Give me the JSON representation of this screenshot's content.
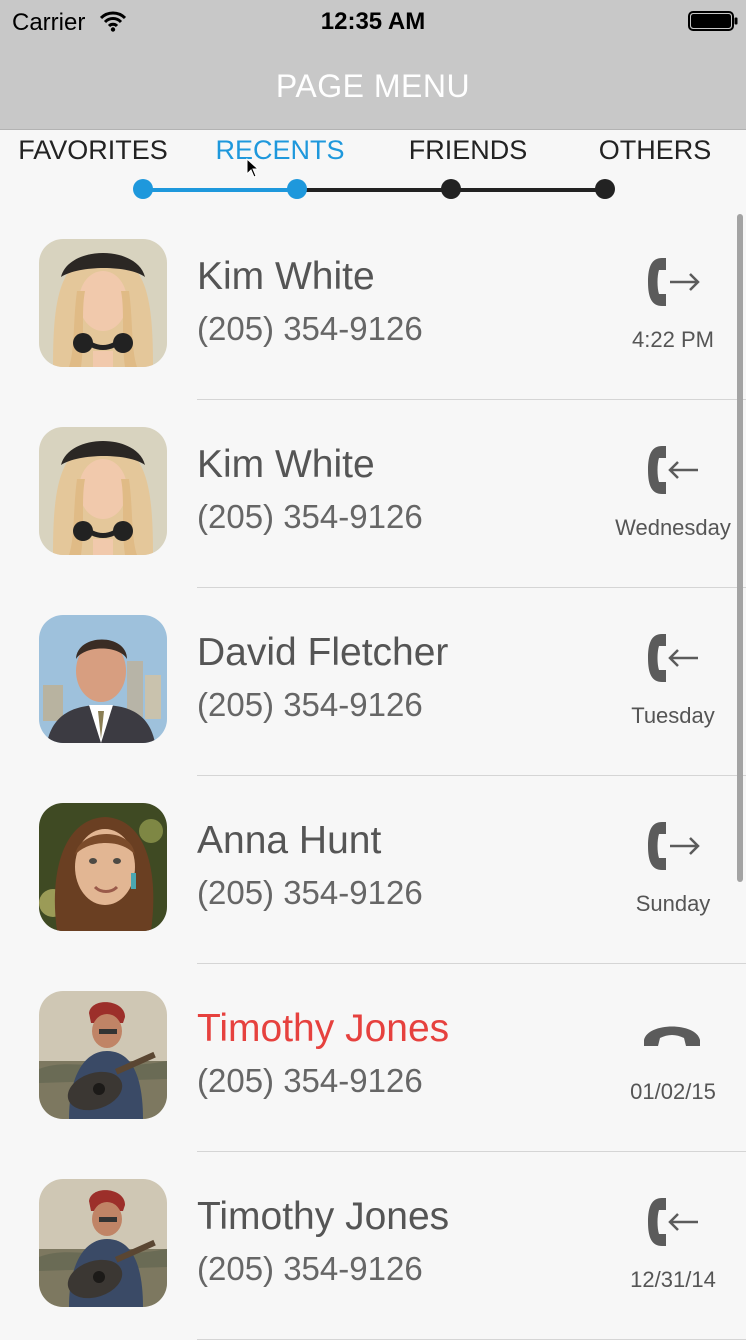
{
  "status_bar": {
    "carrier": "Carrier",
    "time": "12:35 AM"
  },
  "nav": {
    "title": "PAGE MENU"
  },
  "tabs": [
    {
      "label": "FAVORITES",
      "active": false
    },
    {
      "label": "RECENTS",
      "active": true
    },
    {
      "label": "FRIENDS",
      "active": false
    },
    {
      "label": "OTHERS",
      "active": false
    }
  ],
  "page_progress": {
    "active_color": "#1e98dc",
    "inactive_color": "#222222"
  },
  "calls": [
    {
      "name": "Kim White",
      "phone": "(205) 354-9126",
      "time": "4:22 PM",
      "type": "outgoing",
      "missed": false,
      "avatar": "kim"
    },
    {
      "name": "Kim White",
      "phone": "(205) 354-9126",
      "time": "Wednesday",
      "type": "incoming",
      "missed": false,
      "avatar": "kim"
    },
    {
      "name": "David Fletcher",
      "phone": "(205) 354-9126",
      "time": "Tuesday",
      "type": "incoming",
      "missed": false,
      "avatar": "david"
    },
    {
      "name": "Anna Hunt",
      "phone": "(205) 354-9126",
      "time": "Sunday",
      "type": "outgoing",
      "missed": false,
      "avatar": "anna"
    },
    {
      "name": "Timothy Jones",
      "phone": "(205) 354-9126",
      "time": "01/02/15",
      "type": "missed",
      "missed": true,
      "avatar": "timothy"
    },
    {
      "name": "Timothy Jones",
      "phone": "(205) 354-9126",
      "time": "12/31/14",
      "type": "incoming",
      "missed": false,
      "avatar": "timothy"
    }
  ],
  "colors": {
    "missed_name": "#e6413e",
    "accent": "#1e98dc",
    "nav_bg": "#c8c8c8"
  }
}
